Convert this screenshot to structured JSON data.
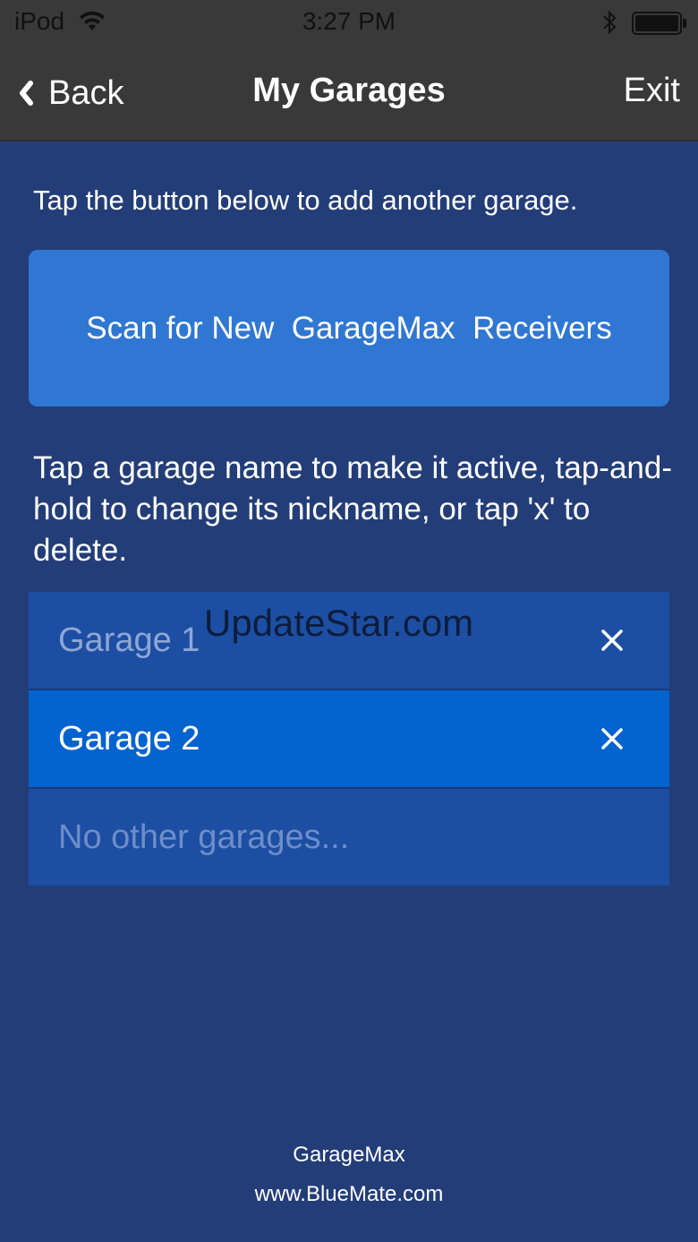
{
  "status_bar": {
    "carrier": "iPod",
    "time": "3:27 PM"
  },
  "nav": {
    "back_label": "Back",
    "title": "My Garages",
    "exit_label": "Exit"
  },
  "content": {
    "intro": "Tap the button below to add another garage.",
    "scan_button_label": "Scan for New  GarageMax  Receivers",
    "instructions": "Tap a garage name to make it active, tap-and-hold to change its nickname, or tap 'x' to delete."
  },
  "garages": [
    {
      "name": "Garage 1",
      "active": false
    },
    {
      "name": "Garage 2",
      "active": true
    }
  ],
  "empty_row_text": "No other garages...",
  "watermark": "UpdateStar.com",
  "footer": {
    "app_name": "GarageMax",
    "website": "www.BlueMate.com"
  },
  "colors": {
    "background": "#233d78",
    "nav_bar": "#393939",
    "scan_button": "#2f77d2",
    "row": "#1c4fa3",
    "row_active": "#0363cf"
  },
  "icons": {
    "wifi": "wifi-icon",
    "bluetooth": "bluetooth-icon",
    "battery": "battery-icon",
    "back": "chevron-left-icon",
    "delete": "close-icon"
  }
}
